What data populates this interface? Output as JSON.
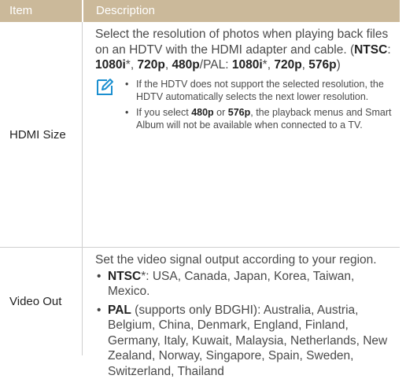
{
  "header": {
    "item": "Item",
    "description": "Description"
  },
  "hdmi": {
    "name": "HDMI Size",
    "intro": "Select the resolution of photos when playing back files on an HDTV with the HDMI adapter and cable. (",
    "ntsc_label": "NTSC",
    "sep1": ": ",
    "v1080i": "1080i",
    "star": "*",
    "comma": ", ",
    "v720p": "720p",
    "v480p": "480p",
    "pal_label": "/PAL: ",
    "v576p": "576p",
    "close": ")",
    "notes": {
      "icon": "note-pencil-icon",
      "n1": "If the HDTV does not support the selected resolution, the HDTV automatically selects the next lower resolution.",
      "n2_pre": "If you select ",
      "n2_or": " or ",
      "n2_post": ", the playback menus and Smart Album will not be available when connected to a TV."
    }
  },
  "video": {
    "name": "Video Out",
    "intro": "Set the video signal output according to your region.",
    "ntsc_label": "NTSC",
    "ntsc_text": ": USA, Canada, Japan, Korea, Taiwan, Mexico.",
    "pal_label": "PAL",
    "pal_text": " (supports only BDGHI): Australia, Austria, Belgium, China, Denmark, England, Finland, Germany, Italy, Kuwait, Malaysia, Netherlands, New Zealand, Norway, Singapore, Spain, Sweden, Switzerland, Thailand"
  },
  "colors": {
    "header_bg": "#cbb99a",
    "note_icon": "#1b8fd0"
  }
}
